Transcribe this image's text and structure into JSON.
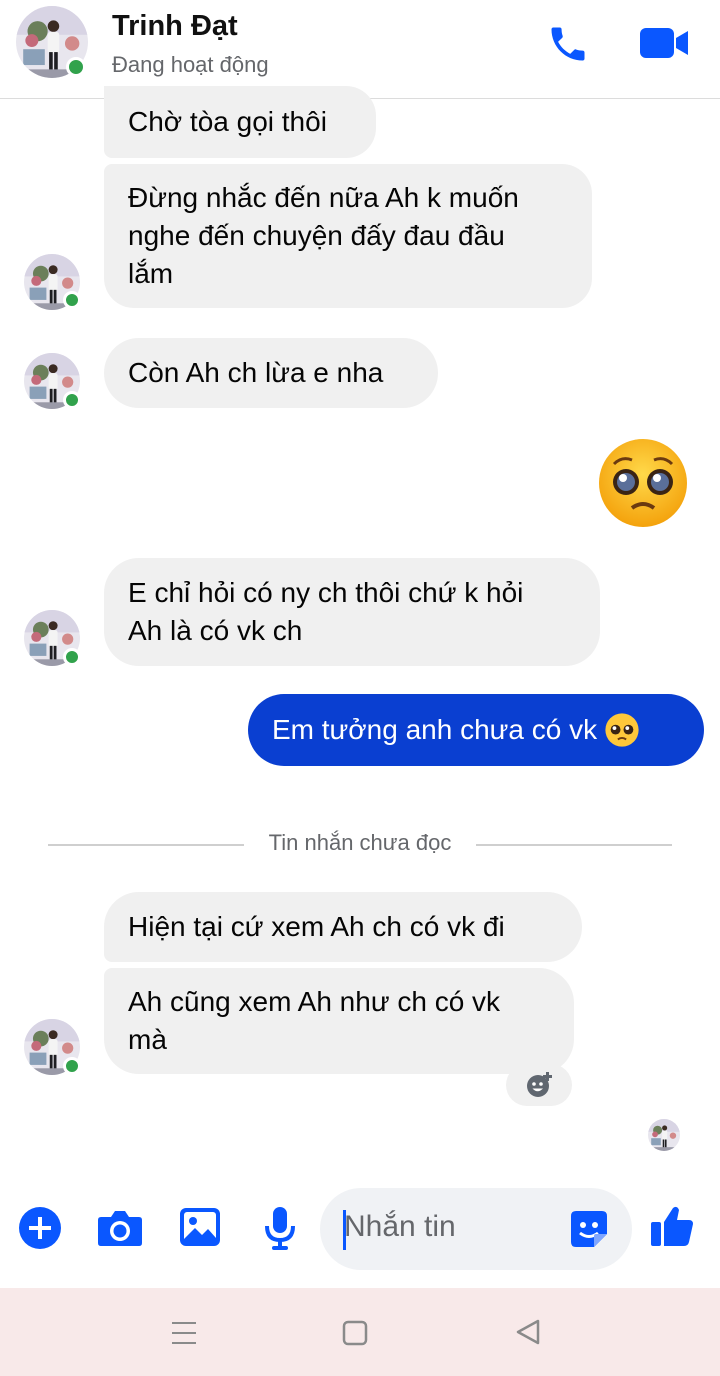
{
  "header": {
    "name": "Trinh Đạt",
    "status": "Đang hoạt động",
    "call_icon": "phone-icon",
    "video_icon": "video-camera-icon"
  },
  "messages": {
    "m1": "Chờ tòa gọi thôi",
    "m2": [
      "Đừng nhắc đến nữa Ah k muốn",
      "nghe đến chuyện đấy đau đầu",
      "lắm"
    ],
    "m3": "Còn Ah ch lừa e nha",
    "m4_emoji": "pleading-face-emoji",
    "m5": [
      "E chỉ hỏi có ny ch thôi chứ k hỏi",
      "Ah là có vk ch"
    ],
    "m6": "Em tưởng anh chưa có vk",
    "m7": "Hiện tại cứ xem Ah ch có vk đi",
    "m8": [
      "Ah cũng xem Ah như ch có vk",
      "mà"
    ]
  },
  "divider": {
    "label": "Tin nhắn chưa đọc"
  },
  "composer": {
    "placeholder": "Nhắn tin",
    "icons": [
      "plus-icon",
      "camera-icon",
      "gallery-icon",
      "microphone-icon",
      "sticker-icon",
      "thumbs-up-icon"
    ]
  },
  "system_nav": {
    "icons": [
      "menu-icon",
      "home-icon",
      "back-icon"
    ]
  },
  "colors": {
    "accent": "#0a57ff",
    "outgoing_bubble": "#0a3fd1",
    "incoming_bubble": "#f0f0f0",
    "online": "#31a24c",
    "nav_bar": "#f8e9e9"
  }
}
